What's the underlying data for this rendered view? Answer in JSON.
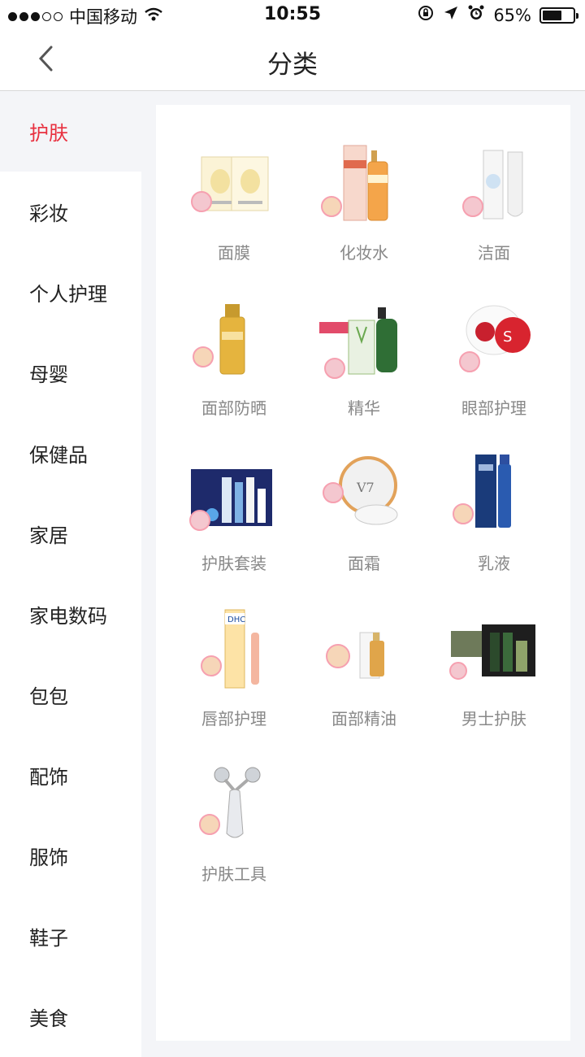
{
  "status_bar": {
    "carrier": "中国移动",
    "time": "10:55",
    "battery_percent": "65%",
    "battery_level": 0.65
  },
  "nav": {
    "title": "分类"
  },
  "sidebar": {
    "items": [
      {
        "label": "护肤",
        "active": true
      },
      {
        "label": "彩妆"
      },
      {
        "label": "个人护理"
      },
      {
        "label": "母婴"
      },
      {
        "label": "保健品"
      },
      {
        "label": "家居"
      },
      {
        "label": "家电数码"
      },
      {
        "label": "包包"
      },
      {
        "label": "配饰"
      },
      {
        "label": "服饰"
      },
      {
        "label": "鞋子"
      },
      {
        "label": "美食"
      }
    ]
  },
  "categories": [
    {
      "label": "面膜",
      "icon": "face-mask-icon"
    },
    {
      "label": "化妆水",
      "icon": "toner-icon"
    },
    {
      "label": "洁面",
      "icon": "cleanser-icon"
    },
    {
      "label": "面部防晒",
      "icon": "sunscreen-icon"
    },
    {
      "label": "精华",
      "icon": "essence-icon"
    },
    {
      "label": "眼部护理",
      "icon": "eye-care-icon"
    },
    {
      "label": "护肤套装",
      "icon": "skincare-set-icon"
    },
    {
      "label": "面霜",
      "icon": "face-cream-icon"
    },
    {
      "label": "乳液",
      "icon": "lotion-icon"
    },
    {
      "label": "唇部护理",
      "icon": "lip-care-icon"
    },
    {
      "label": "面部精油",
      "icon": "face-oil-icon"
    },
    {
      "label": "男士护肤",
      "icon": "men-skincare-icon"
    },
    {
      "label": "护肤工具",
      "icon": "skincare-tool-icon"
    }
  ],
  "colors": {
    "accent": "#e8303f",
    "background": "#f4f5f8"
  }
}
